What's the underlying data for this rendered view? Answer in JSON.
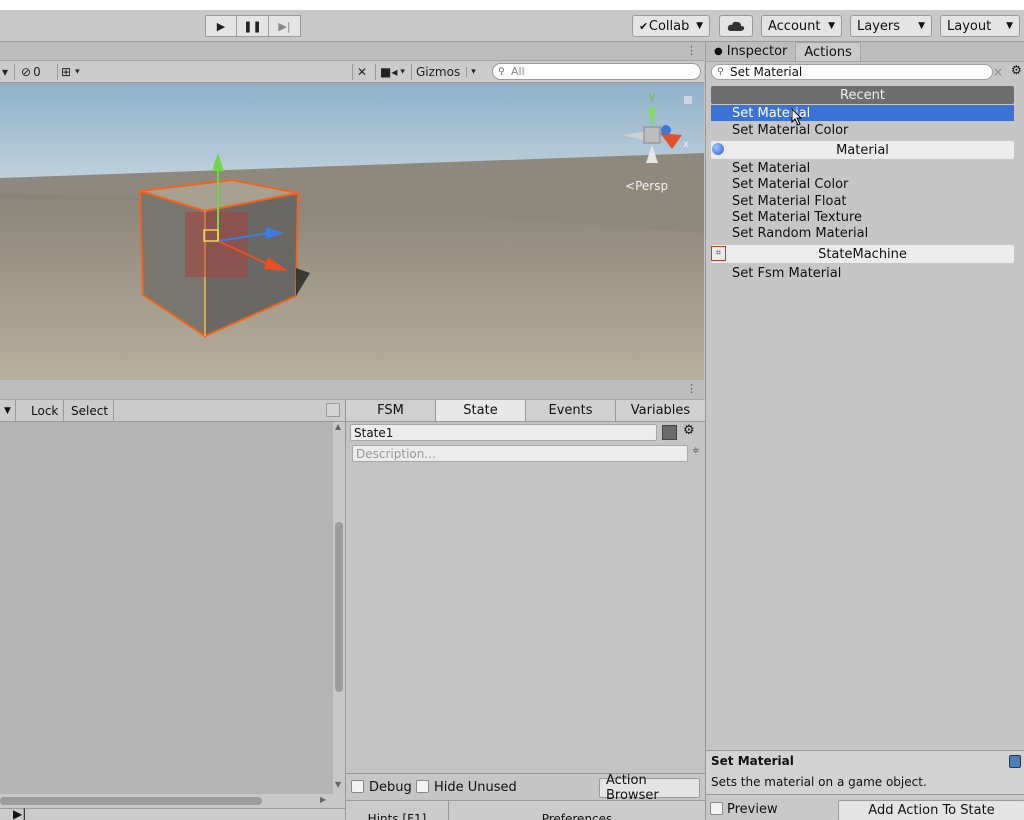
{
  "toolbar": {
    "collab": "Collab",
    "account": "Account",
    "layers": "Layers",
    "layout": "Layout"
  },
  "scene": {
    "hidden_count": "0",
    "gizmos": "Gizmos",
    "search_placeholder": "All",
    "persp": "Persp",
    "axis_y": "y",
    "axis_x": "x"
  },
  "fsm_bar": {
    "lock": "Lock",
    "select": "Select"
  },
  "state_panel": {
    "tabs": [
      "FSM",
      "State",
      "Events",
      "Variables"
    ],
    "state_name": "State1",
    "description_placeholder": "Description...",
    "debug": "Debug",
    "hide_unused": "Hide Unused",
    "action_browser": "Action Browser",
    "hints": "Hints [F1]",
    "preferences": "Preferences"
  },
  "right_panel": {
    "tab_inspector": "Inspector",
    "tab_actions": "Actions",
    "search_value": "Set Material",
    "recent_header": "Recent",
    "recent_items": [
      "Set Material",
      "Set Material Color"
    ],
    "material_header": "Material",
    "material_items": [
      "Set Material",
      "Set Material Color",
      "Set Material Float",
      "Set Material Texture",
      "Set Random Material"
    ],
    "statemachine_header": "StateMachine",
    "statemachine_items": [
      "Set Fsm Material"
    ],
    "desc_title": "Set Material",
    "desc_text": "Sets the material on a game object.",
    "preview": "Preview",
    "add_action": "Add Action To State"
  },
  "colors": {
    "selection": "#3a72d8",
    "selection_outline": "#f06420"
  }
}
